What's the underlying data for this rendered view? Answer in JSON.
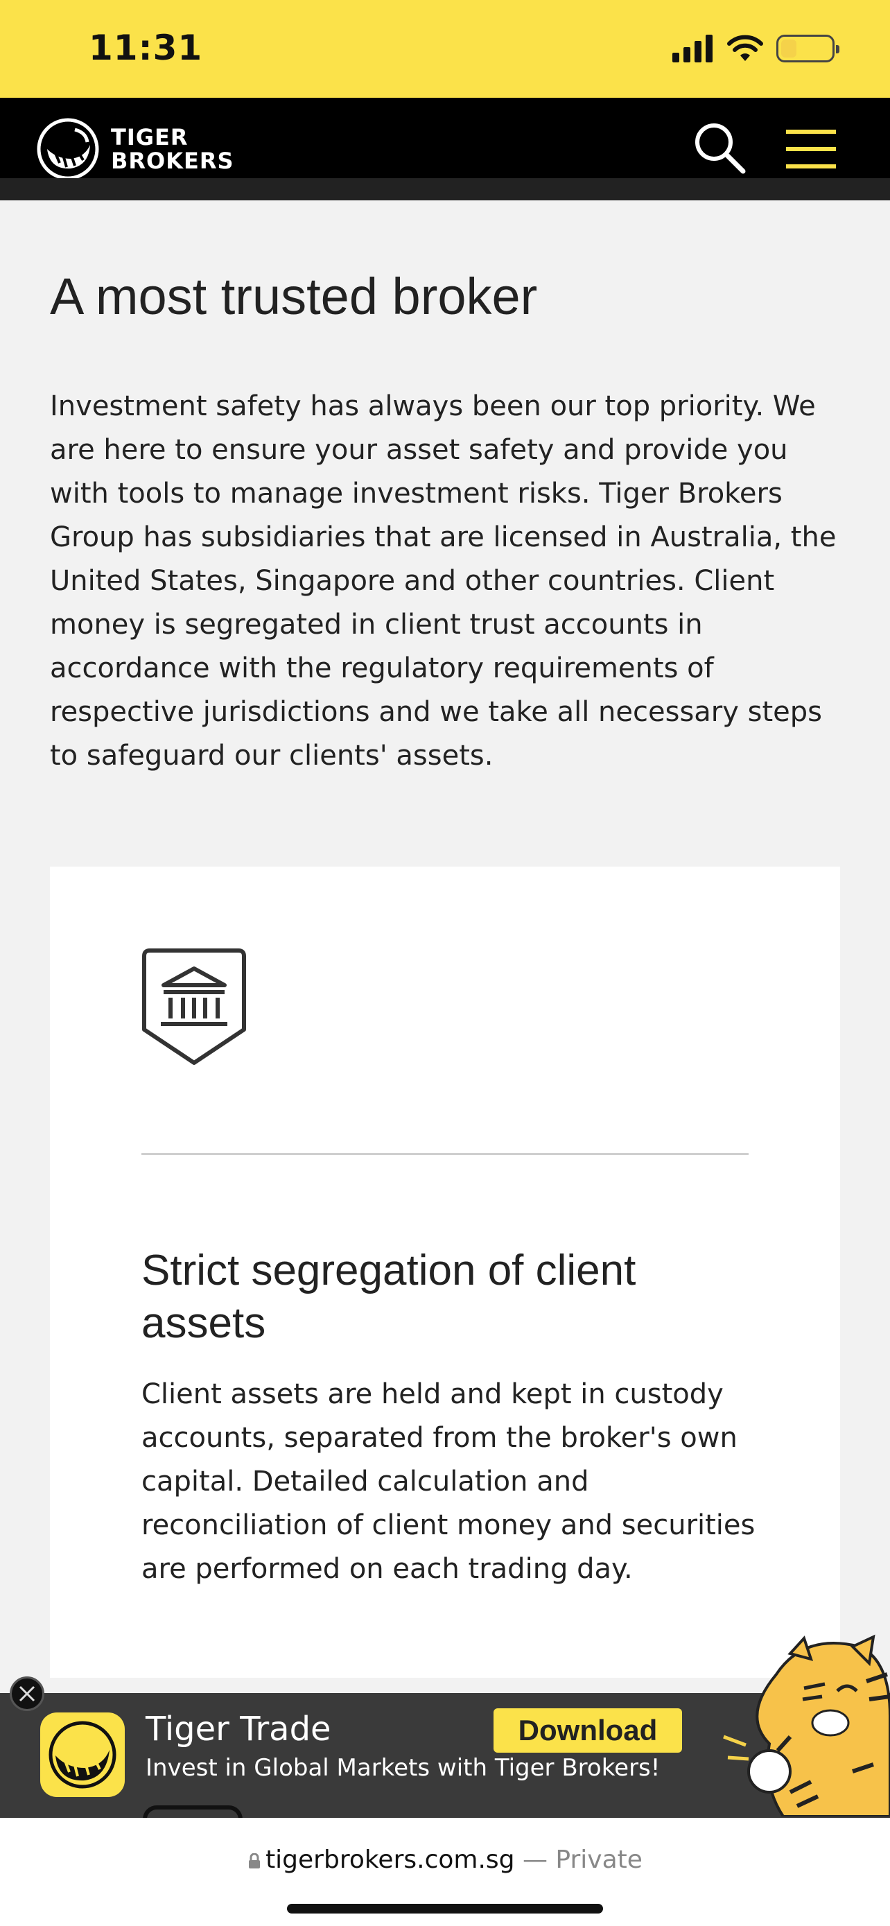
{
  "status_bar": {
    "time": "11:31"
  },
  "header": {
    "logo_line1": "TIGER",
    "logo_line2": "BROKERS"
  },
  "main": {
    "title": "A most trusted broker",
    "intro": "Investment safety has always been our top priority. We are here to ensure your asset safety and provide you with tools to manage investment risks. Tiger Brokers Group has subsidiaries that are licensed in Australia, the United States, Singapore and other countries. Client money is segregated in client trust accounts in accordance with the regulatory requirements of respective jurisdictions and we take all necessary steps to safeguard our clients' assets.",
    "card": {
      "icon": "bank-shield-icon",
      "title": "Strict segregation of client assets",
      "body": "Client assets are held and kept in custody accounts, separated from the broker's own capital. Detailed calculation and reconciliation of client money and securities are performed on each trading day."
    }
  },
  "app_banner": {
    "title": "Tiger Trade",
    "subtitle": "Invest in Global Markets with Tiger Brokers!",
    "download_label": "Download"
  },
  "browser": {
    "domain": "tigerbrokers.com.sg",
    "separator": " — ",
    "mode": "Private"
  },
  "colors": {
    "brand_yellow": "#fbe24a",
    "header_black": "#000000",
    "page_bg": "#f2f2f2",
    "banner_bg": "#3a3a3a"
  }
}
